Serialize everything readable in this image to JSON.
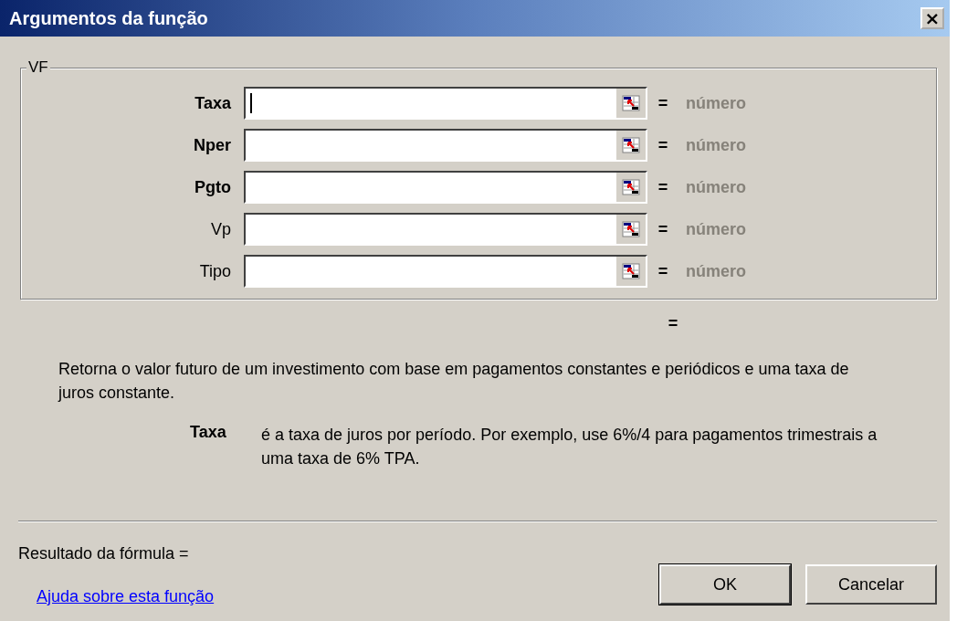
{
  "window": {
    "title": "Argumentos da função",
    "close_label": "×"
  },
  "group": {
    "title": "VF",
    "arguments": [
      {
        "label": "Taxa",
        "required": true,
        "focused": true,
        "equals": "=",
        "value": "número"
      },
      {
        "label": "Nper",
        "required": true,
        "focused": false,
        "equals": "=",
        "value": "número"
      },
      {
        "label": "Pgto",
        "required": true,
        "focused": false,
        "equals": "=",
        "value": "número"
      },
      {
        "label": "Vp",
        "required": false,
        "focused": false,
        "equals": "=",
        "value": "número"
      },
      {
        "label": "Tipo",
        "required": false,
        "focused": false,
        "equals": "=",
        "value": "número"
      }
    ]
  },
  "result_equals": "=",
  "description": "Retorna o valor futuro de um investimento com base em pagamentos constantes e periódicos e uma taxa de juros constante.",
  "argument_help": {
    "name": "Taxa",
    "text": "é a taxa de juros por período. Por exemplo, use 6%/4 para pagamentos trimestrais a uma taxa de 6% TPA."
  },
  "formula_result": "Resultado da fórmula =",
  "help_link": "Ajuda sobre esta função",
  "buttons": [
    "OK",
    "Cancelar"
  ]
}
